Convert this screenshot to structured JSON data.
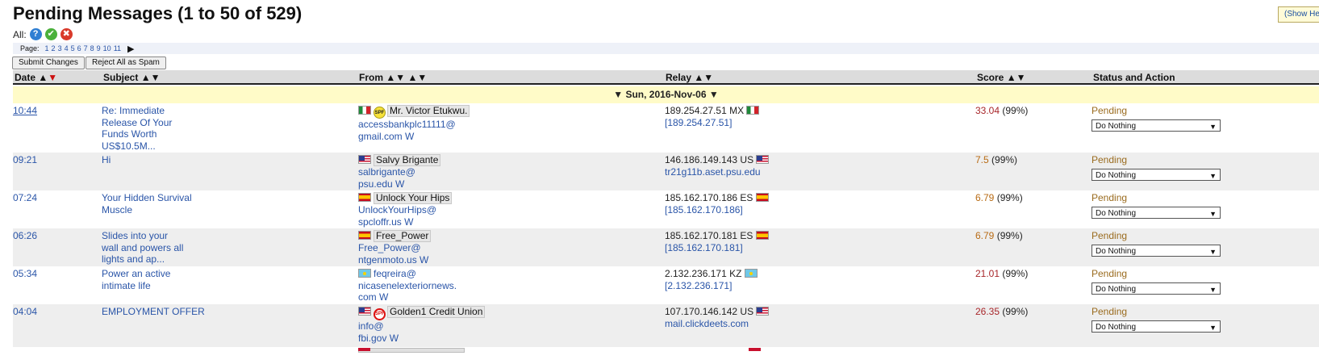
{
  "page": {
    "title": "Pending Messages (1 to 50 of 529)",
    "show_help": "(Show Help)"
  },
  "all_row": {
    "label": "All:"
  },
  "pager": {
    "label": "Page:",
    "pages": [
      "1",
      "2",
      "3",
      "4",
      "5",
      "6",
      "7",
      "8",
      "9",
      "10",
      "11"
    ],
    "next_glyph": "▶"
  },
  "buttons": {
    "submit": "Submit Changes",
    "reject_all": "Reject All as Spam"
  },
  "columns": {
    "date": "Date",
    "subject": "Subject",
    "from": "From",
    "relay": "Relay",
    "score": "Score",
    "status": "Status and Action"
  },
  "sort_glyphs": {
    "asc": "▲",
    "desc": "▼"
  },
  "day_header": "▼ Sun, 2016-Nov-06 ▼",
  "messages": [
    {
      "time": "10:44",
      "subject": [
        "Re: Immediate",
        "Release Of Your",
        "Funds Worth",
        "US$10.5M..."
      ],
      "from_flag": "mx",
      "spf": "pass",
      "sender_name": "Mr. Victor Etukwu.",
      "email_user": "accessbankplc11111@",
      "email_domain": "gmail.com W",
      "relay_ip": "189.254.27.51 MX",
      "relay_flag": "mx",
      "relay_host": "[189.254.27.51]",
      "score": "33.04",
      "score_color": "red",
      "score_pct": "(99%)",
      "status": "Pending",
      "action": "Do Nothing"
    },
    {
      "time": "09:21",
      "subject": [
        "Hi"
      ],
      "from_flag": "us",
      "spf": "",
      "sender_name": "Salvy Brigante",
      "email_user": "salbrigante@",
      "email_domain": "psu.edu W",
      "relay_ip": "146.186.149.143 US",
      "relay_flag": "us",
      "relay_host": "tr21g11b.aset.psu.edu",
      "score": "7.5",
      "score_color": "orange",
      "score_pct": "(99%)",
      "status": "Pending",
      "action": "Do Nothing"
    },
    {
      "time": "07:24",
      "subject": [
        "Your Hidden Survival",
        "Muscle"
      ],
      "from_flag": "es",
      "spf": "",
      "sender_name": "Unlock Your Hips",
      "email_user": "UnlockYourHips@",
      "email_domain": "spcloffr.us W",
      "relay_ip": "185.162.170.186 ES",
      "relay_flag": "es",
      "relay_host": "[185.162.170.186]",
      "score": "6.79",
      "score_color": "orange",
      "score_pct": "(99%)",
      "status": "Pending",
      "action": "Do Nothing"
    },
    {
      "time": "06:26",
      "subject": [
        "Slides into your",
        "wall and powers all",
        "lights and ap..."
      ],
      "from_flag": "es",
      "spf": "",
      "sender_name": "Free_Power",
      "email_user": "Free_Power@",
      "email_domain": "ntgenmoto.us W",
      "relay_ip": "185.162.170.181 ES",
      "relay_flag": "es",
      "relay_host": "[185.162.170.181]",
      "score": "6.79",
      "score_color": "orange",
      "score_pct": "(99%)",
      "status": "Pending",
      "action": "Do Nothing"
    },
    {
      "time": "05:34",
      "subject": [
        "Power an active",
        "intimate life"
      ],
      "from_flag": "kz",
      "spf": "",
      "sender_name": "",
      "email_user": "feqreira@",
      "email_domain": "nicasenelexteriornews.\ncom W",
      "relay_ip": "2.132.236.171 KZ",
      "relay_flag": "kz",
      "relay_host": "[2.132.236.171]",
      "score": "21.01",
      "score_color": "red",
      "score_pct": "(99%)",
      "status": "Pending",
      "action": "Do Nothing"
    },
    {
      "time": "04:04",
      "subject": [
        "EMPLOYMENT OFFER"
      ],
      "from_flag": "us",
      "spf": "fail",
      "sender_name": "Golden1 Credit Union",
      "email_user": "info@",
      "email_domain": "fbi.gov W",
      "relay_ip": "107.170.146.142 US",
      "relay_flag": "us",
      "relay_host": "mail.clickdeets.com",
      "score": "26.35",
      "score_color": "red",
      "score_pct": "(99%)",
      "status": "Pending",
      "action": "Do Nothing"
    }
  ],
  "icons": {
    "help": "?",
    "approve": "✔",
    "reject": "✖",
    "spf_pass": "SPF",
    "spf_fail": "SPF"
  },
  "colors": {
    "link": "#2a55a8",
    "score_red": "#a8262a",
    "score_orange": "#b86b14",
    "pending": "#9a6b1e",
    "day_header_bg": "#fffbc8",
    "alt_row_bg": "#eeeeee"
  }
}
